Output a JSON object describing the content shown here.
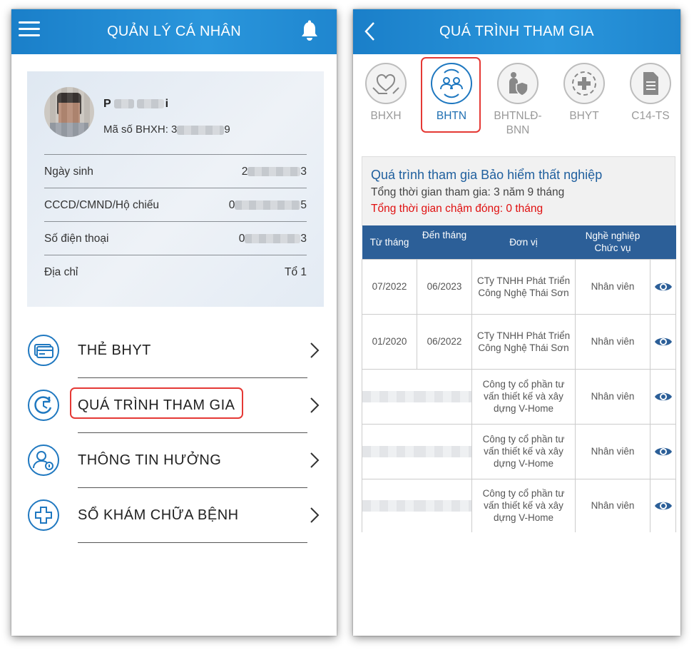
{
  "left": {
    "header": {
      "title": "QUẢN LÝ CÁ NHÂN"
    },
    "profile": {
      "name_prefix": "P",
      "name_suffix": "i",
      "code_label": "Mã số BHXH: 3",
      "code_suffix": "9",
      "rows": [
        {
          "label": "Ngày sinh",
          "value_prefix": "2",
          "value_suffix": "3"
        },
        {
          "label": "CCCD/CMND/Hộ chiếu",
          "value_prefix": "0",
          "value_suffix": "5"
        },
        {
          "label": "Số điện thoại",
          "value_prefix": "0",
          "value_suffix": "3"
        },
        {
          "label": "Địa chỉ",
          "value_prefix": "",
          "value_suffix": "Tổ 1"
        }
      ]
    },
    "menu": [
      {
        "label": "THẺ BHYT",
        "icon": "card-icon"
      },
      {
        "label": "QUÁ TRÌNH THAM GIA",
        "icon": "history-icon"
      },
      {
        "label": "THÔNG TIN HƯỞNG",
        "icon": "user-info-icon"
      },
      {
        "label": "SỔ KHÁM CHỮA BỆNH",
        "icon": "medical-cross-icon"
      }
    ]
  },
  "right": {
    "header": {
      "title": "QUÁ TRÌNH THAM GIA"
    },
    "tabs": [
      {
        "label": "BHXH",
        "icon": "hands-heart-icon"
      },
      {
        "label": "BHTN",
        "icon": "people-exchange-icon"
      },
      {
        "label": "BHTNLĐ-BNN",
        "icon": "worker-shield-icon"
      },
      {
        "label": "BHYT",
        "icon": "medical-cross-icon"
      },
      {
        "label": "C14-TS",
        "icon": "document-icon"
      }
    ],
    "summary": {
      "title": "Quá trình tham gia Bảo hiểm thất nghiệp",
      "total": "Tổng thời gian tham gia: 3 năm 9 tháng",
      "late": "Tổng thời gian chậm đóng: 0 tháng"
    },
    "table": {
      "headers": {
        "from": "Từ tháng",
        "to": "Đến tháng",
        "unit": "Đơn vị",
        "job1": "Nghề nghiệp",
        "job2": "Chức vụ"
      },
      "rows": [
        {
          "from": "07/2022",
          "to": "06/2023",
          "unit": "CTy TNHH Phát Triển Công Nghệ Thái Sơn",
          "job": "Nhân viên"
        },
        {
          "from": "01/2020",
          "to": "06/2022",
          "unit": "CTy TNHH Phát Triển Công Nghệ Thái Sơn",
          "job": "Nhân viên"
        },
        {
          "from": "",
          "to": "",
          "unit": "Công ty cổ phần tư vấn thiết kế và xây dựng V-Home",
          "job": "Nhân viên"
        },
        {
          "from": "",
          "to": "",
          "unit": "Công ty cổ phần tư vấn thiết kế và xây dựng V-Home",
          "job": "Nhân viên"
        },
        {
          "from": "",
          "to": "",
          "unit": "Công ty cổ phần tư vấn thiết kế và xây dựng V-Home",
          "job": "Nhân viên"
        }
      ]
    }
  },
  "colors": {
    "header_blue": "#1f86cf",
    "table_header": "#2c5f98",
    "highlight_red": "#e53935",
    "late_red": "#e01010",
    "title_blue": "#1f5f9e"
  }
}
